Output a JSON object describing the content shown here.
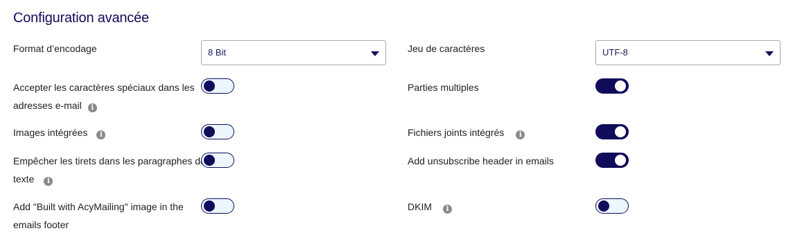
{
  "section": {
    "title": "Configuration avancée"
  },
  "left": {
    "encoding_label": "Format d’encodage",
    "encoding_value": "8 Bit",
    "special_chars_line1": "Accepter les caractères spéciaux dans les",
    "special_chars_line2": "adresses e-mail",
    "special_chars_on": false,
    "embed_images_label": "Images intégrées",
    "embed_images_on": false,
    "no_dashes_line1": "Empêcher les tirets dans les paragraphes de",
    "no_dashes_line2": "texte",
    "no_dashes_on": false,
    "built_with_line1": "Add \"Built with AcyMailing\" image in the",
    "built_with_line2": "emails footer",
    "built_with_on": false
  },
  "right": {
    "charset_label": "Jeu de caractères",
    "charset_value": "UTF-8",
    "multipart_label": "Parties multiples",
    "multipart_on": true,
    "embed_attachments_label": "Fichiers joints intégrés",
    "embed_attachments_on": true,
    "unsubscribe_header_label": "Add unsubscribe header in emails",
    "unsubscribe_header_on": true,
    "dkim_label": "DKIM",
    "dkim_on": false
  },
  "icons": {
    "info_glyph": "i"
  },
  "colors": {
    "accent": "#100c5a",
    "toggle_off_bg": "#ecf6fd",
    "info_icon": "#8a8a8a"
  }
}
